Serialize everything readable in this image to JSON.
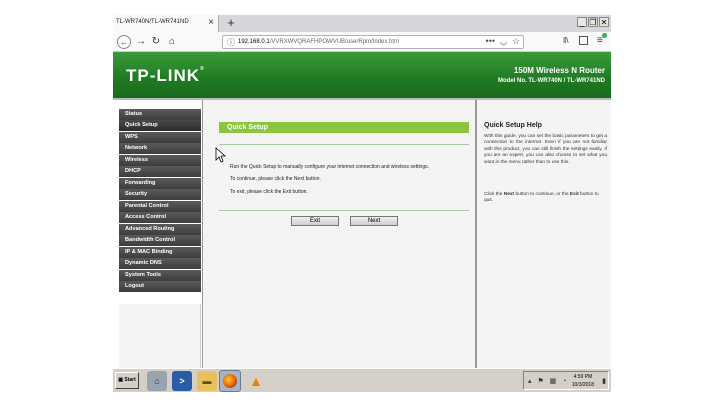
{
  "browser": {
    "tab_title": "TL-WR740N/TL-WR741ND",
    "tab_close": "×",
    "new_tab": "+",
    "window_controls": {
      "minimize": "_",
      "restore": "❐",
      "close": "✕"
    },
    "url_host": "192.168.0.1",
    "url_path": "/VVRXWVQRAFHPOWVUB/userRpm/Index.htm",
    "page_actions": "•••",
    "icons": {
      "back": "left-arrow-icon",
      "forward": "right-arrow-icon",
      "reload": "reload-icon",
      "home": "home-icon",
      "info": "info-icon",
      "pocket": "pocket-icon",
      "bookmark": "star-icon",
      "library": "library-icon",
      "sidebar": "sidebar-icon",
      "menu": "hamburger-menu-icon"
    }
  },
  "router": {
    "logo": "TP-LINK",
    "logo_mark": "®",
    "product_name": "150M Wireless N Router",
    "model_number": "Model No. TL-WR740N / TL-WR741ND",
    "brand_color": "#1f7a22"
  },
  "menu": {
    "items": [
      "Status",
      "Quick Setup",
      "WPS",
      "Network",
      "Wireless",
      "DHCP",
      "Forwarding",
      "Security",
      "Parental Control",
      "Access Control",
      "Advanced Routing",
      "Bandwidth Control",
      "IP & MAC Binding",
      "Dynamic DNS",
      "System Tools",
      "Logout"
    ],
    "active": "Quick Setup"
  },
  "quick_setup": {
    "header": "Quick Setup",
    "description": "Run the Quick Setup to manually configure your internet connection and wireless settings.",
    "continue_text": "To continue, please click the Next button.",
    "exit_text": "To exit, please click the Exit button.",
    "exit_label": "Exit",
    "next_label": "Next",
    "accent_color": "#8cc63f"
  },
  "help": {
    "title": "Quick Setup Help",
    "paragraph1": "With this guide, you can set the basic parameters to get a connection to the internet. Even if you are not familiar with this product, you can still finish the settings easily. If you are an expert, you can also choose to set what you want in the menu rather than to use this.",
    "paragraph2_prefix": "Click the ",
    "paragraph2_next": "Next",
    "paragraph2_mid": " button to continue, or the ",
    "paragraph2_exit": "Exit",
    "paragraph2_suffix": " button to quit."
  },
  "taskbar": {
    "start_label": "Start",
    "tray_icons": "▴ ⚑ ▦ ◔",
    "time": "4:59 PM",
    "date": "10/3/2018",
    "show_desktop": "▮",
    "icons": {
      "network": "network-icon",
      "powershell": "powershell-icon",
      "explorer": "folder-icon",
      "firefox": "firefox-icon",
      "vlc": "vlc-icon"
    }
  }
}
